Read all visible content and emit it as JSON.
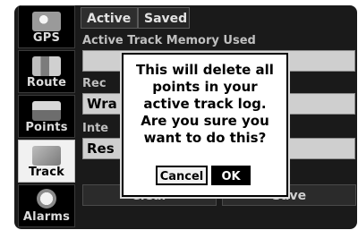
{
  "sidebar": {
    "items": [
      {
        "label": "GPS",
        "icon": "satellite-icon"
      },
      {
        "label": "Route",
        "icon": "route-icon"
      },
      {
        "label": "Points",
        "icon": "waypoints-icon"
      },
      {
        "label": "Track",
        "icon": "track-icon"
      },
      {
        "label": "Alarms",
        "icon": "alarm-clock-icon"
      }
    ]
  },
  "tabs": {
    "active": "Active",
    "saved": "Saved"
  },
  "content": {
    "memory_label": "Active Track Memory Used",
    "record_label_partial": "Rec",
    "record_value_partial": "Wra",
    "interval_label_partial": "Inte",
    "interval_value_partial": "Res"
  },
  "buttons": {
    "clear": "Clear",
    "save": "Save"
  },
  "dialog": {
    "message": "This will delete all points in your active track log.  Are you sure you want to do this?",
    "cancel": "Cancel",
    "ok": "OK"
  }
}
